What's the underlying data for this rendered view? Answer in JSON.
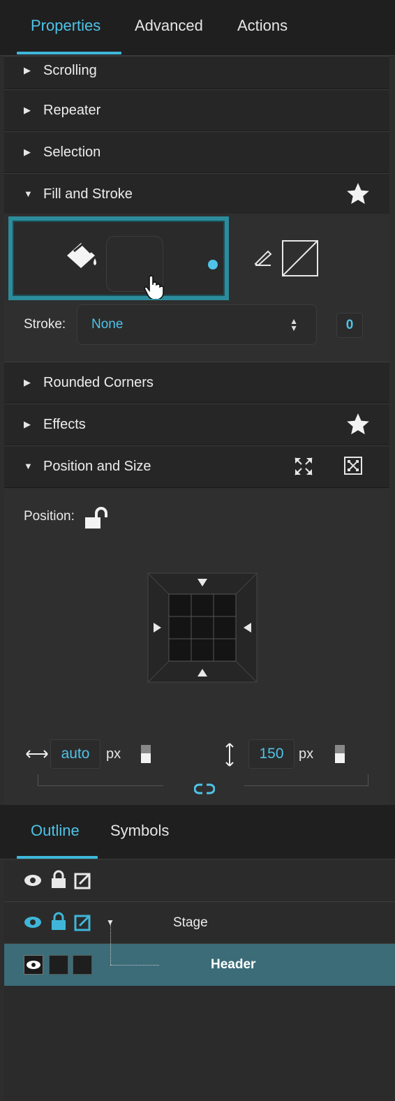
{
  "tabs": {
    "properties": "Properties",
    "advanced": "Advanced",
    "actions": "Actions"
  },
  "sections": {
    "scrolling": "Scrolling",
    "repeater": "Repeater",
    "selection": "Selection",
    "fill_stroke": "Fill and Stroke",
    "rounded_corners": "Rounded Corners",
    "effects": "Effects",
    "position_size": "Position and Size"
  },
  "fill": {
    "stroke_label": "Stroke:",
    "stroke_value": "None",
    "stroke_width": "0"
  },
  "position": {
    "label": "Position:",
    "width_value": "auto",
    "width_unit": "px",
    "height_value": "150",
    "height_unit": "px"
  },
  "outline": {
    "tab_outline": "Outline",
    "tab_symbols": "Symbols",
    "stage_label": "Stage",
    "header_label": "Header"
  },
  "colors": {
    "accent": "#4fc3e8",
    "selection_row": "#3b6c78",
    "focus_border": "#2c8c9c"
  }
}
